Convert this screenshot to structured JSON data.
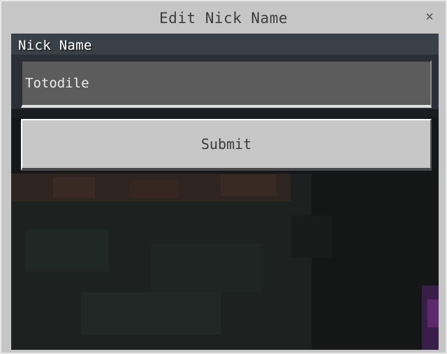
{
  "dialog": {
    "title": "Edit Nick Name",
    "close_glyph": "×"
  },
  "form": {
    "nick_label": "Nick Name",
    "nick_value": "Totodile",
    "submit_label": "Submit"
  },
  "colors": {
    "panel": "#c6c6c6",
    "input_bg": "#5c5c5c",
    "button_bg": "#c7c7c7",
    "label_text": "#ffffff"
  }
}
